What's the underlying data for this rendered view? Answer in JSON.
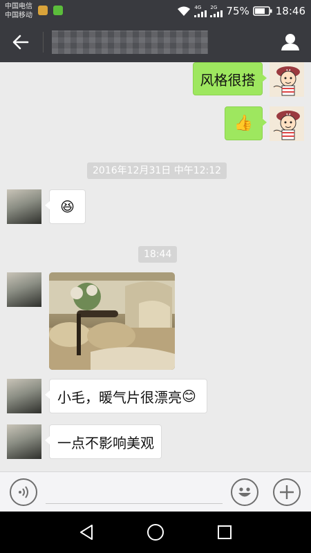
{
  "status_bar": {
    "carrier_1": "中国电信",
    "carrier_2": "中国移动",
    "network_1": "4G",
    "network_2": "2G",
    "battery": "75%",
    "time": "18:46"
  },
  "header": {
    "title": "",
    "back_icon": "arrow-left-icon",
    "profile_icon": "person-icon"
  },
  "messages": {
    "out_1": "风格很搭",
    "out_2_emoji": "👍",
    "ts_1": "2016年12月31日 中午12:12",
    "in_1_emoji": "😆",
    "ts_2": "18:44",
    "in_3": "小毛，暖气片很漂亮",
    "in_3_emoji": "😊",
    "in_4": "一点不影响美观"
  },
  "input_bar": {
    "value": "",
    "voice_icon": "voice-icon",
    "emoji_icon": "emoji-icon",
    "more_icon": "plus-icon"
  },
  "nav_bar": {
    "back_icon": "triangle-back-icon",
    "home_icon": "circle-home-icon",
    "recents_icon": "square-recents-icon"
  },
  "colors": {
    "header_bg": "#393a3f",
    "chat_bg": "#ebebeb",
    "outgoing_bubble": "#9ee75f",
    "incoming_bubble": "#ffffff"
  }
}
